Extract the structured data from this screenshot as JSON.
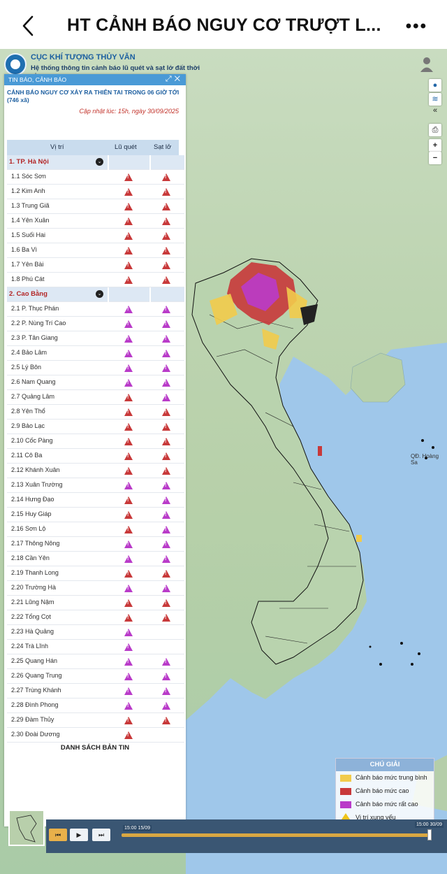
{
  "app": {
    "title": "HT CẢNH BÁO NGUY CƠ TRƯỢT L..."
  },
  "portal": {
    "org": "CỤC KHÍ TƯỢNG THỦY VĂN",
    "system": "Hệ thống thông tin cảnh báo lũ quét và sạt lở đất thời gian"
  },
  "panel": {
    "bar_label": "TIN BÁO, CẢNH BÁO",
    "title": "CẢNH BÁO NGUY CƠ XẢY RA THIÊN TAI TRONG 06 GIỜ TỚI (746 xã)",
    "updated": "Cập nhật lúc: 15h, ngày 30/09/2025",
    "columns": {
      "location": "Vị trí",
      "flash_flood": "Lũ quét",
      "landslide": "Sạt lở"
    },
    "bulletins": "DANH SÁCH BẢN TIN"
  },
  "rows": [
    {
      "name": "1. TP. Hà Nội",
      "group": true
    },
    {
      "name": "1.1  Sóc Sơn",
      "a": "high",
      "b": "high"
    },
    {
      "name": "1.2  Kim Anh",
      "a": "high",
      "b": "high"
    },
    {
      "name": "1.3  Trung Giã",
      "a": "high",
      "b": "high"
    },
    {
      "name": "1.4  Yên Xuân",
      "a": "high",
      "b": "high"
    },
    {
      "name": "1.5  Suối Hai",
      "a": "high",
      "b": "high"
    },
    {
      "name": "1.6  Ba Vì",
      "a": "high",
      "b": "high"
    },
    {
      "name": "1.7  Yên Bài",
      "a": "high",
      "b": "high"
    },
    {
      "name": "1.8  Phú Cát",
      "a": "high",
      "b": "high"
    },
    {
      "name": "2. Cao Bằng",
      "group": true
    },
    {
      "name": "2.1  P. Thục Phán",
      "a": "vhigh",
      "b": "vhigh"
    },
    {
      "name": "2.2  P. Nùng Trí Cao",
      "a": "vhigh",
      "b": "vhigh"
    },
    {
      "name": "2.3  P. Tân Giang",
      "a": "vhigh",
      "b": "vhigh"
    },
    {
      "name": "2.4  Bảo Lâm",
      "a": "vhigh",
      "b": "vhigh"
    },
    {
      "name": "2.5  Lý Bôn",
      "a": "vhigh",
      "b": "vhigh"
    },
    {
      "name": "2.6  Nam Quang",
      "a": "vhigh",
      "b": "vhigh"
    },
    {
      "name": "2.7  Quảng Lâm",
      "a": "high",
      "b": "vhigh"
    },
    {
      "name": "2.8  Yên Thổ",
      "a": "high",
      "b": "high"
    },
    {
      "name": "2.9  Bảo Lạc",
      "a": "high",
      "b": "high"
    },
    {
      "name": "2.10  Cốc Pàng",
      "a": "high",
      "b": "high"
    },
    {
      "name": "2.11  Cô Ba",
      "a": "high",
      "b": "high"
    },
    {
      "name": "2.12  Khánh Xuân",
      "a": "high",
      "b": "high"
    },
    {
      "name": "2.13  Xuân Trường",
      "a": "vhigh",
      "b": "vhigh"
    },
    {
      "name": "2.14  Hưng Đạo",
      "a": "high",
      "b": "vhigh"
    },
    {
      "name": "2.15  Huy Giáp",
      "a": "high",
      "b": "vhigh"
    },
    {
      "name": "2.16  Sơn Lộ",
      "a": "high",
      "b": "vhigh"
    },
    {
      "name": "2.17  Thông Nông",
      "a": "vhigh",
      "b": "vhigh"
    },
    {
      "name": "2.18  Cần Yên",
      "a": "vhigh",
      "b": "vhigh"
    },
    {
      "name": "2.19  Thanh Long",
      "a": "high",
      "b": "high"
    },
    {
      "name": "2.20  Trường Hà",
      "a": "vhigh",
      "b": "vhigh"
    },
    {
      "name": "2.21  Lũng Nậm",
      "a": "high",
      "b": "high"
    },
    {
      "name": "2.22  Tổng Cọt",
      "a": "high",
      "b": "high"
    },
    {
      "name": "2.23  Hà Quảng",
      "a": "vhigh",
      "b": ""
    },
    {
      "name": "2.24  Trà Lĩnh",
      "a": "vhigh",
      "b": ""
    },
    {
      "name": "2.25  Quang Hán",
      "a": "vhigh",
      "b": "vhigh"
    },
    {
      "name": "2.26  Quang Trung",
      "a": "vhigh",
      "b": "vhigh"
    },
    {
      "name": "2.27  Trùng Khánh",
      "a": "vhigh",
      "b": "vhigh"
    },
    {
      "name": "2.28  Đình Phong",
      "a": "vhigh",
      "b": "vhigh"
    },
    {
      "name": "2.29  Đàm Thủy",
      "a": "high",
      "b": "high"
    },
    {
      "name": "2.30  Đoài Dương",
      "a": "high",
      "b": ""
    }
  ],
  "legend": {
    "title": "CHÚ GIẢI",
    "items": [
      {
        "label": "Cảnh báo mức trung bình",
        "color": "#f2cb4b"
      },
      {
        "label": "Cảnh báo mức cao",
        "color": "#c8393a"
      },
      {
        "label": "Cảnh báo mức rất cao",
        "color": "#b93bc9"
      },
      {
        "label": "Vị trí xung yếu",
        "color": "#f0c419"
      }
    ]
  },
  "map": {
    "island_label": "QĐ. Hoàng Sa"
  },
  "timeline": {
    "start": "15:00 15/09",
    "end": "15:00 30/09"
  },
  "colors": {
    "high": "#c8393a",
    "very_high": "#b93bc9",
    "medium": "#f2cb4b",
    "sea": "#9fc7ea"
  }
}
